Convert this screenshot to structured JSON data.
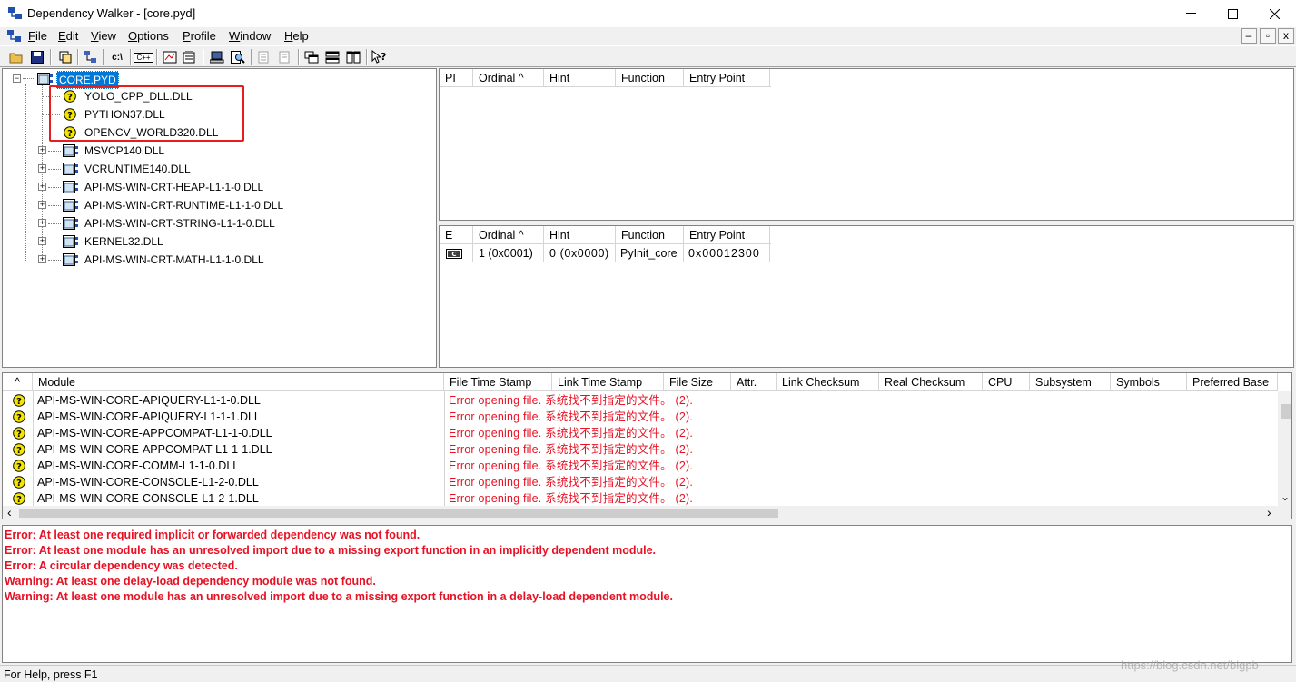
{
  "window": {
    "title": "Dependency Walker - [core.pyd]",
    "min_glyph": "─",
    "max_glyph": "☐",
    "close_glyph": "✕"
  },
  "menu": {
    "items": [
      "File",
      "Edit",
      "View",
      "Options",
      "Profile",
      "Window",
      "Help"
    ],
    "mdi_min": "–",
    "mdi_restore": "▫",
    "mdi_close": "x"
  },
  "toolbar": {
    "c_label": "c:\\",
    "cpp_label": "C++"
  },
  "tree": {
    "root": "CORE.PYD",
    "children": [
      {
        "label": "YOLO_CPP_DLL.DLL",
        "status": "missing",
        "expandable": false
      },
      {
        "label": "PYTHON37.DLL",
        "status": "missing",
        "expandable": false
      },
      {
        "label": "OPENCV_WORLD320.DLL",
        "status": "missing",
        "expandable": false
      },
      {
        "label": "MSVCP140.DLL",
        "status": "ok",
        "expandable": true
      },
      {
        "label": "VCRUNTIME140.DLL",
        "status": "ok",
        "expandable": true
      },
      {
        "label": "API-MS-WIN-CRT-HEAP-L1-1-0.DLL",
        "status": "ok",
        "expandable": true
      },
      {
        "label": "API-MS-WIN-CRT-RUNTIME-L1-1-0.DLL",
        "status": "ok",
        "expandable": true
      },
      {
        "label": "API-MS-WIN-CRT-STRING-L1-1-0.DLL",
        "status": "ok",
        "expandable": true
      },
      {
        "label": "KERNEL32.DLL",
        "status": "ok",
        "expandable": true
      },
      {
        "label": "API-MS-WIN-CRT-MATH-L1-1-0.DLL",
        "status": "ok",
        "expandable": true
      }
    ]
  },
  "imports": {
    "columns": [
      "PI",
      "Ordinal ^",
      "Hint",
      "Function",
      "Entry Point"
    ]
  },
  "exports": {
    "columns": [
      "E",
      "Ordinal ^",
      "Hint",
      "Function",
      "Entry Point"
    ],
    "rows": [
      {
        "ordinal": "1 (0x0001)",
        "hint": "0 (0x0000)",
        "function": "PyInit_core",
        "entry_point": "0x00012300"
      }
    ]
  },
  "modules": {
    "columns": [
      "^",
      "Module",
      "File Time Stamp",
      "Link Time Stamp",
      "File Size",
      "Attr.",
      "Link Checksum",
      "Real Checksum",
      "CPU",
      "Subsystem",
      "Symbols",
      "Preferred Base"
    ],
    "rows": [
      {
        "module": "API-MS-WIN-CORE-APIQUERY-L1-1-0.DLL",
        "error": "Error opening file. 系统找不到指定的文件。 (2)."
      },
      {
        "module": "API-MS-WIN-CORE-APIQUERY-L1-1-1.DLL",
        "error": "Error opening file. 系统找不到指定的文件。 (2)."
      },
      {
        "module": "API-MS-WIN-CORE-APPCOMPAT-L1-1-0.DLL",
        "error": "Error opening file. 系统找不到指定的文件。 (2)."
      },
      {
        "module": "API-MS-WIN-CORE-APPCOMPAT-L1-1-1.DLL",
        "error": "Error opening file. 系统找不到指定的文件。 (2)."
      },
      {
        "module": "API-MS-WIN-CORE-COMM-L1-1-0.DLL",
        "error": "Error opening file. 系统找不到指定的文件。 (2)."
      },
      {
        "module": "API-MS-WIN-CORE-CONSOLE-L1-2-0.DLL",
        "error": "Error opening file. 系统找不到指定的文件。 (2)."
      },
      {
        "module": "API-MS-WIN-CORE-CONSOLE-L1-2-1.DLL",
        "error": "Error opening file. 系统找不到指定的文件。 (2)."
      }
    ],
    "scroll_left": "‹",
    "scroll_right": "›",
    "scroll_down": "⌄"
  },
  "log": [
    "Error: At least one required implicit or forwarded dependency was not found.",
    "Error: At least one module has an unresolved import due to a missing export function in an implicitly dependent module.",
    "Error: A circular dependency was detected.",
    "Warning: At least one delay-load dependency module was not found.",
    "Warning: At least one module has an unresolved import due to a missing export function in a delay-load dependent module."
  ],
  "status": "For Help, press F1",
  "watermark": "https://blog.csdn.net/bigpb",
  "colors": {
    "accent_selection": "#0078d7",
    "error_red": "#e81123",
    "highlight_box": "#e81c1c",
    "question_icon": "#f5e600"
  }
}
